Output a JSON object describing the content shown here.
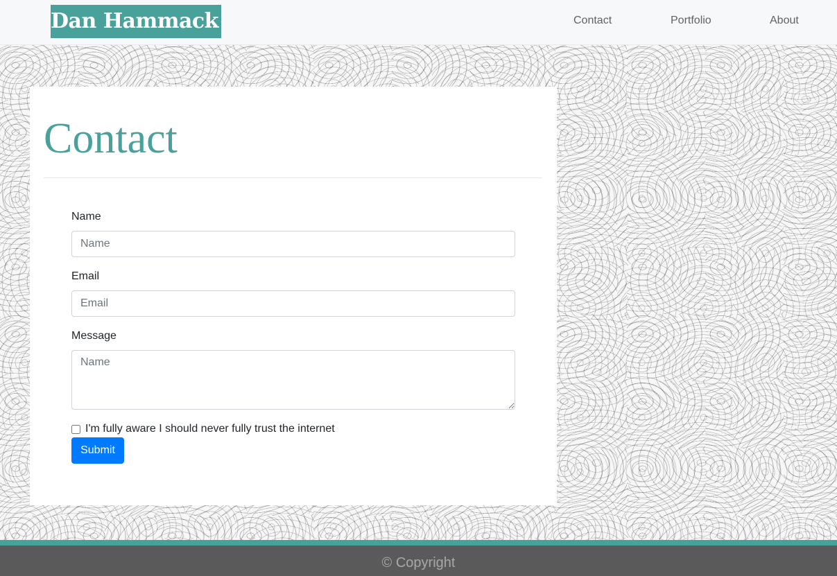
{
  "navbar": {
    "brand": "Dan Hammack",
    "links": [
      {
        "label": "Contact"
      },
      {
        "label": "Portfolio"
      },
      {
        "label": "About"
      }
    ]
  },
  "main": {
    "title": "Contact",
    "form": {
      "name_label": "Name",
      "name_placeholder": "Name",
      "email_label": "Email",
      "email_placeholder": "Email",
      "message_label": "Message",
      "message_placeholder": "Name",
      "checkbox_label": "I'm fully aware I should never fully trust the internet",
      "checkbox_checked": false,
      "submit_label": "Submit"
    }
  },
  "footer": {
    "copyright": "© Copyright"
  },
  "colors": {
    "accent": "#48a19a",
    "primary_button": "#007bff",
    "footer_bg": "#5a5a5a"
  }
}
